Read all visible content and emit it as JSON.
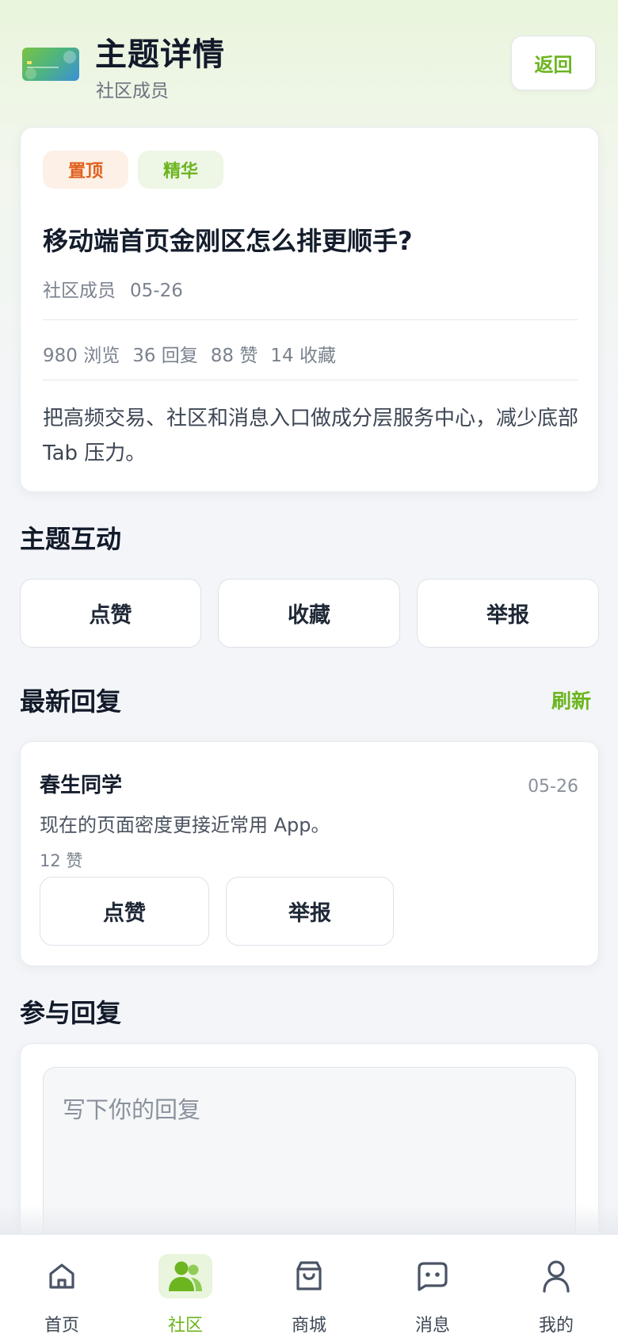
{
  "header": {
    "title": "主题详情",
    "subtitle": "社区成员",
    "back_label": "返回"
  },
  "topic": {
    "tags": [
      "置顶",
      "精华"
    ],
    "title": "移动端首页金刚区怎么排更顺手?",
    "author": "社区成员",
    "date": "05-26",
    "stats": {
      "views": "980 浏览",
      "replies": "36 回复",
      "likes": "88 赞",
      "favorites": "14 收藏"
    },
    "body": "把高频交易、社区和消息入口做成分层服务中心，减少底部 Tab 压力。"
  },
  "interaction": {
    "title": "主题互动",
    "like_label": "点赞",
    "favorite_label": "收藏",
    "report_label": "举报"
  },
  "latest_replies": {
    "title": "最新回复",
    "refresh_label": "刷新",
    "items": [
      {
        "author": "春生同学",
        "date": "05-26",
        "text": "现在的页面密度更接近常用 App。",
        "likes": "12 赞",
        "like_label": "点赞",
        "report_label": "举报"
      }
    ]
  },
  "compose": {
    "title": "参与回复",
    "placeholder": "写下你的回复",
    "value": ""
  },
  "tabbar": {
    "active": "社区",
    "items": [
      {
        "label": "首页",
        "icon": "home-icon"
      },
      {
        "label": "社区",
        "icon": "community-icon"
      },
      {
        "label": "商城",
        "icon": "shopping-bag-icon"
      },
      {
        "label": "消息",
        "icon": "message-icon"
      },
      {
        "label": "我的",
        "icon": "profile-icon"
      }
    ]
  },
  "colors": {
    "accent": "#6cb51f",
    "pinned_tag": "#e0601e",
    "text_primary": "#121a2a",
    "text_secondary": "#7a828e"
  }
}
